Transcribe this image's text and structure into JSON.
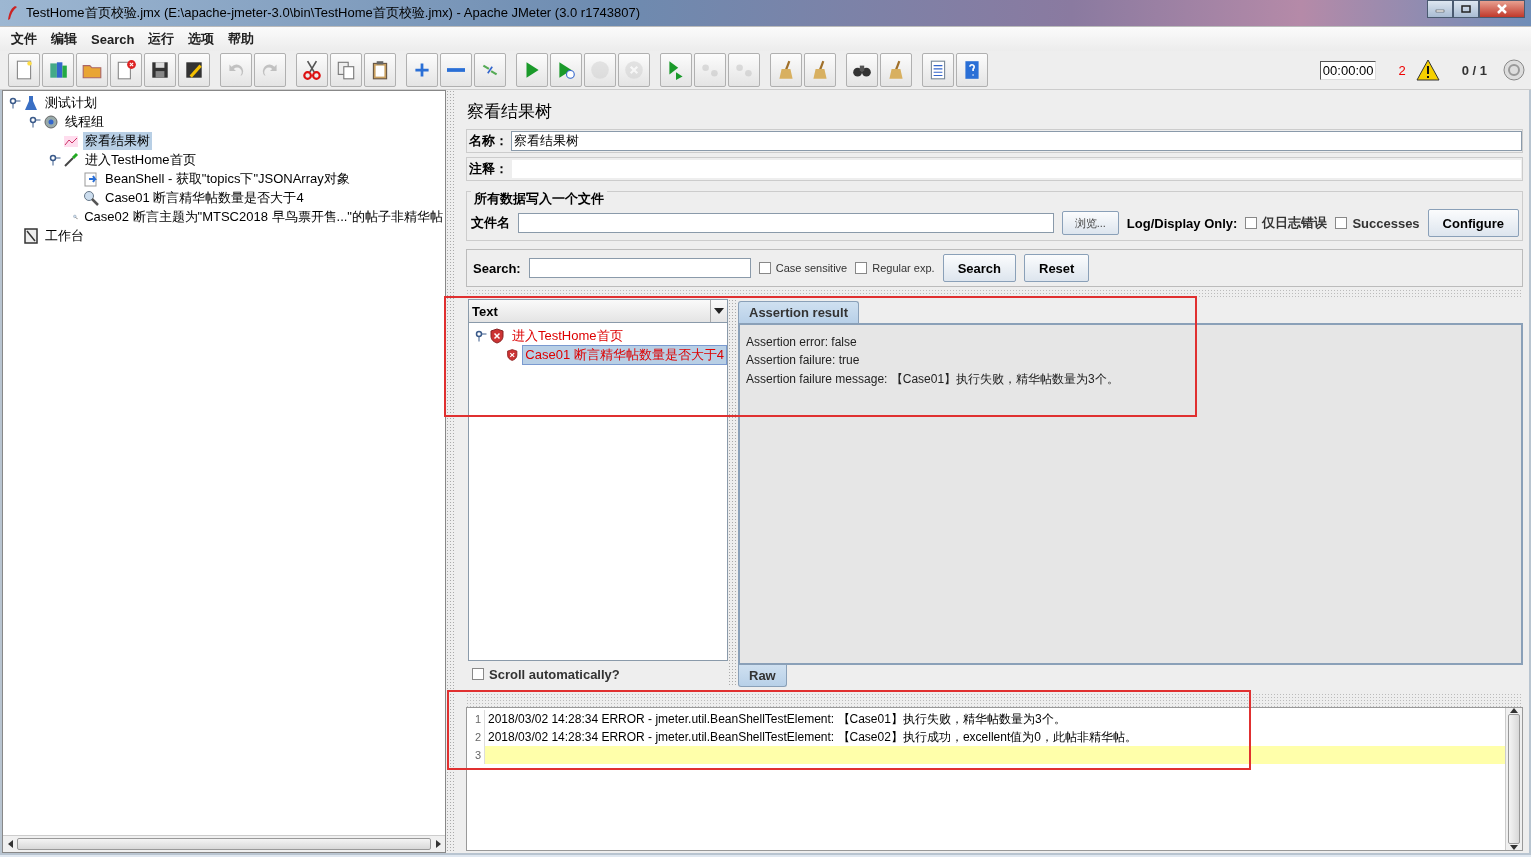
{
  "window": {
    "title": "TestHome首页校验.jmx (E:\\apache-jmeter-3.0\\bin\\TestHome首页校验.jmx) - Apache JMeter (3.0 r1743807)"
  },
  "menu": [
    "文件",
    "编辑",
    "Search",
    "运行",
    "选项",
    "帮助"
  ],
  "toolbar": {
    "groups": [
      [
        {
          "disabled": false
        },
        {
          "disabled": false
        },
        {
          "disabled": false
        },
        {
          "disabled": false
        },
        {
          "disabled": false
        },
        {
          "disabled": false
        }
      ],
      [
        {
          "disabled": true
        },
        {
          "disabled": true
        }
      ],
      [
        {
          "disabled": false
        },
        {
          "disabled": false
        },
        {
          "disabled": false
        }
      ],
      [
        {
          "disabled": false
        },
        {
          "disabled": false
        },
        {
          "disabled": false
        }
      ],
      [
        {
          "disabled": false
        },
        {
          "disabled": false
        },
        {
          "disabled": true
        },
        {
          "disabled": true
        }
      ],
      [
        {
          "disabled": false
        },
        {
          "disabled": true
        },
        {
          "disabled": true
        }
      ],
      [
        {
          "disabled": false
        },
        {
          "disabled": false
        }
      ],
      [
        {
          "disabled": false
        },
        {
          "disabled": false
        }
      ],
      [
        {
          "disabled": false
        },
        {
          "disabled": false
        }
      ]
    ],
    "timer": "00:00:00",
    "error_count": "2",
    "threads": "0 / 1"
  },
  "tree": [
    {
      "label": "测试计划",
      "kind": "plan",
      "selected": false,
      "expanded": true,
      "children": [
        {
          "label": "线程组",
          "kind": "threads",
          "selected": false,
          "expanded": true,
          "children": [
            {
              "label": "察看结果树",
              "kind": "listener",
              "selected": true
            },
            {
              "label": "进入TestHome首页",
              "kind": "sampler",
              "selected": false,
              "expanded": true,
              "children": [
                {
                  "label": "BeanShell - 获取\"topics下\"JSONArray对象",
                  "kind": "postprocessor",
                  "selected": false
                },
                {
                  "label": "Case01 断言精华帖数量是否大于4",
                  "kind": "assertion",
                  "selected": false
                },
                {
                  "label": "Case02 断言主题为\"MTSC2018 早鸟票开售...\"的帖子非精华帖",
                  "kind": "assertion",
                  "selected": false
                }
              ]
            }
          ]
        }
      ]
    },
    {
      "label": "工作台",
      "kind": "workbench",
      "selected": false
    }
  ],
  "editor": {
    "title": "察看结果树",
    "name_label": "名称：",
    "name_value": "察看结果树",
    "comment_label": "注释：",
    "file_group": {
      "title": "所有数据写入一个文件",
      "file_label": "文件名",
      "browse": "浏览...",
      "log_label": "Log/Display Only:",
      "options": [
        {
          "label": "仅日志错误",
          "checked": false
        },
        {
          "label": "Successes",
          "checked": false
        }
      ],
      "configure": "Configure"
    },
    "search": {
      "label": "Search:",
      "options": [
        {
          "label": "Case sensitive",
          "checked": false
        },
        {
          "label": "Regular exp.",
          "checked": false
        }
      ],
      "buttons": [
        "Search",
        "Reset"
      ]
    }
  },
  "results": {
    "highlighted": true,
    "renderer": "Text",
    "tree": [
      {
        "label": "进入TestHome首页",
        "failed": true,
        "selected": false,
        "expanded": true,
        "children": [
          {
            "label": "Case01 断言精华帖数量是否大于4",
            "failed": true,
            "selected": true
          }
        ]
      }
    ],
    "scroll_auto": {
      "label": "Scroll automatically?",
      "checked": false
    },
    "tabs": [
      {
        "label": "Assertion result",
        "selected": true
      }
    ],
    "lines": [
      "Assertion error: false",
      "Assertion failure: true",
      "Assertion failure message: 【Case01】执行失败，精华帖数量为3个。"
    ],
    "bottom_tabs": [
      {
        "label": "Raw",
        "selected": true
      }
    ]
  },
  "log": {
    "highlighted": true,
    "lines": [
      {
        "number": "1",
        "text": "2018/03/02 14:28:34 ERROR - jmeter.util.BeanShellTestElement: 【Case01】执行失败，精华帖数量为3个。",
        "current": false
      },
      {
        "number": "2",
        "text": "2018/03/02 14:28:34 ERROR - jmeter.util.BeanShellTestElement: 【Case02】执行成功，excellent值为0，此帖非精华帖。",
        "current": false
      },
      {
        "number": "3",
        "current": true
      }
    ]
  }
}
